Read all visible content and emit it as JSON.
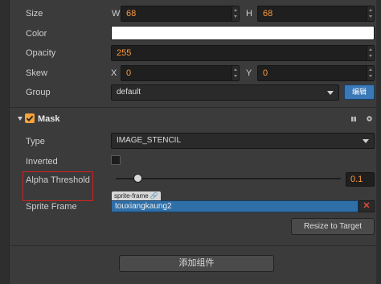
{
  "props": {
    "size": {
      "label": "Size",
      "w_label": "W",
      "w_value": "68",
      "h_label": "H",
      "h_value": "68"
    },
    "color": {
      "label": "Color",
      "value": "#ffffff"
    },
    "opacity": {
      "label": "Opacity",
      "value": "255"
    },
    "skew": {
      "label": "Skew",
      "x_label": "X",
      "x_value": "0",
      "y_label": "Y",
      "y_value": "0"
    },
    "group": {
      "label": "Group",
      "value": "default",
      "edit_label": "编辑"
    }
  },
  "mask": {
    "title": "Mask",
    "enabled": true,
    "type": {
      "label": "Type",
      "value": "IMAGE_STENCIL"
    },
    "inverted": {
      "label": "Inverted",
      "checked": false
    },
    "alpha_threshold": {
      "label": "Alpha Threshold",
      "value": "0.1",
      "fraction": 0.1
    },
    "sprite_frame": {
      "label": "Sprite Frame",
      "tag": "sprite-frame",
      "value": "touxiangkaung2"
    },
    "resize_label": "Resize to Target"
  },
  "add_component_label": "添加组件",
  "colors": {
    "accent": "#f3a33a",
    "selected_field": "#2f6fa8",
    "edit_button": "#3a79b7",
    "annotation": "#d92020",
    "value_text": "#ff9a3c"
  }
}
